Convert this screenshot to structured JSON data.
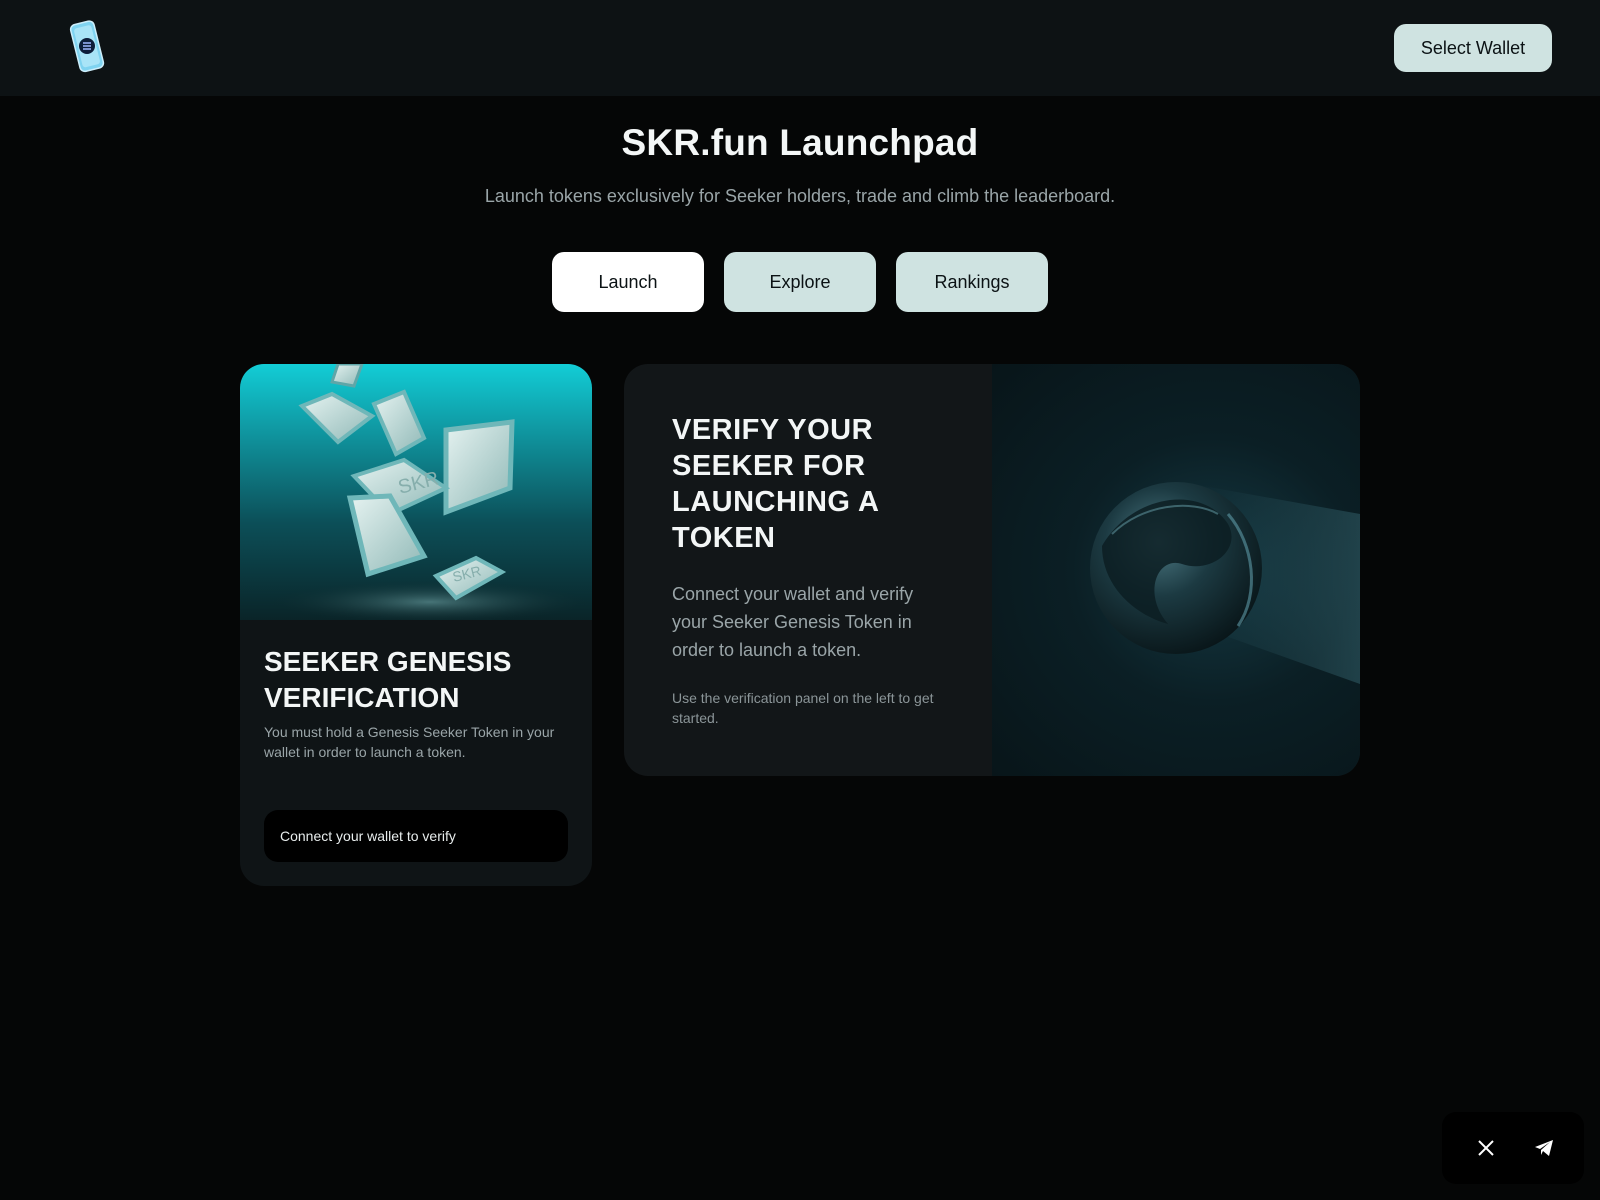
{
  "header": {
    "logo_icon": "seeker-phone-logo-icon",
    "select_wallet_label": "Select Wallet"
  },
  "hero": {
    "title": "SKR.fun Launchpad",
    "subtitle": "Launch tokens exclusively for Seeker holders, trade and climb the leaderboard."
  },
  "tabs": [
    {
      "label": "Launch",
      "active": true
    },
    {
      "label": "Explore",
      "active": false
    },
    {
      "label": "Rankings",
      "active": false
    }
  ],
  "genesis_card": {
    "token_label_1": "SKR",
    "token_label_2": "SKR",
    "title": "SEEKER GENESIS VERIFICATION",
    "description": "You must hold a Genesis Seeker Token in your wallet in order to launch a token.",
    "status": "Connect your wallet to verify"
  },
  "verify_card": {
    "title": "VERIFY YOUR SEEKER FOR LAUNCHING A TOKEN",
    "description": "Connect your wallet and verify your Seeker Genesis Token in order to launch a token.",
    "hint": "Use the verification panel on the left to get started."
  },
  "social": {
    "x_icon": "x-twitter-icon",
    "telegram_icon": "telegram-icon"
  },
  "colors": {
    "page_bg": "#050606",
    "topbar_bg": "#0d1214",
    "button_mint": "#cfe3e1",
    "accent_cyan": "#12cdd6"
  }
}
